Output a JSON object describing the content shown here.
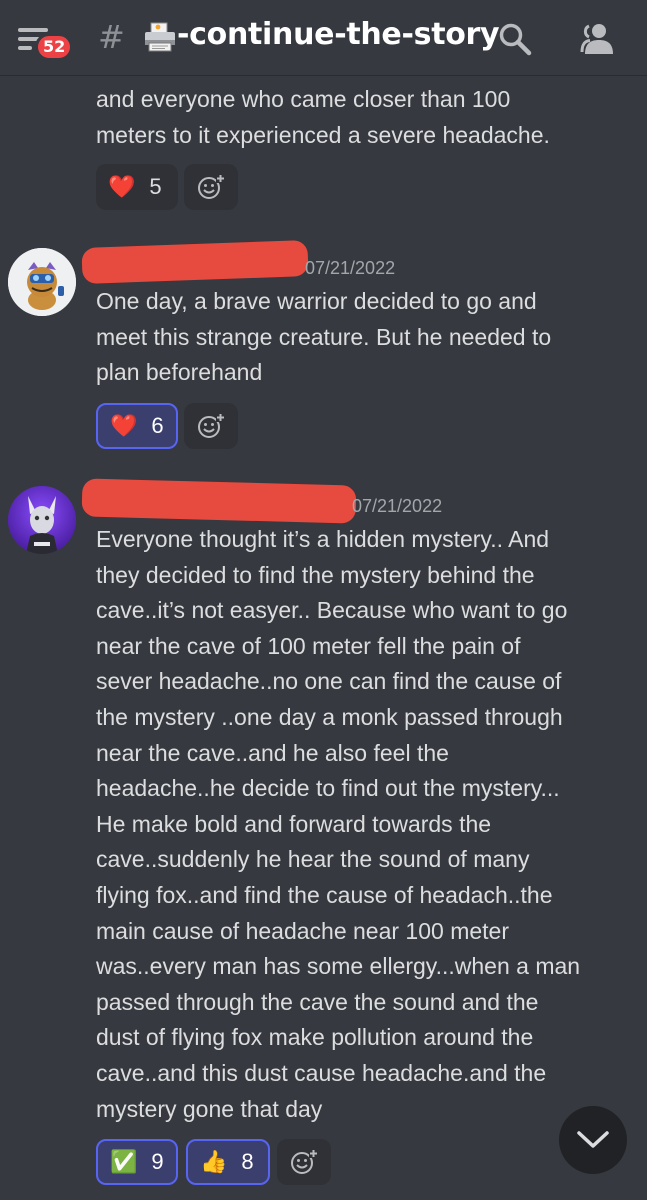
{
  "header": {
    "unread_badge": "52",
    "hash_symbol": "#",
    "channel_name": "-continue-the-story",
    "channel_emoji": "printer-icon"
  },
  "messages": [
    {
      "text_lines": [
        "and everyone who came closer than 100",
        "meters to it experienced a severe headache."
      ],
      "reactions": [
        {
          "emoji": "❤️",
          "icon": "red-heart-icon",
          "count": "5",
          "active": false
        }
      ]
    },
    {
      "timestamp": "07/21/2022",
      "text_lines": [
        "One day, a brave warrior decided to go and",
        "meet this strange creature. But he needed to",
        "plan beforehand"
      ],
      "reactions": [
        {
          "emoji": "❤️",
          "icon": "red-heart-icon",
          "count": "6",
          "active": true
        }
      ]
    },
    {
      "timestamp": "07/21/2022",
      "text_lines": [
        "Everyone thought it’s a hidden mystery.. And",
        "they decided to find the mystery behind the",
        "cave..it’s not easyer.. Because who want to go",
        "near the cave of 100 meter fell the pain of",
        "sever headache..no one can find the cause of",
        "the mystery ..one day a monk passed through",
        "near the cave..and he also feel the",
        "headache..he decide to find out the mystery...",
        "He make bold and forward towards the",
        "cave..suddenly he hear the sound of many",
        "flying fox..and find the cause of headach..the",
        "main cause of headache near 100 meter",
        "was..every man has some ellergy...when a man",
        "passed through the cave the sound and the",
        "dust of flying fox make  pollution around the",
        "cave..and this dust cause headache.and the",
        "mystery gone that day"
      ],
      "reactions": [
        {
          "emoji": "✅",
          "icon": "check-mark-icon",
          "count": "9",
          "active": true
        },
        {
          "emoji": "👍",
          "icon": "thumbs-up-icon",
          "count": "8",
          "active": true
        }
      ]
    }
  ],
  "colors": {
    "background": "#36393f",
    "text": "#dcddde",
    "timestamp": "#a3a6aa",
    "badge": "#ed4245",
    "accent": "#5865f2",
    "redaction": "#e74a3e"
  }
}
